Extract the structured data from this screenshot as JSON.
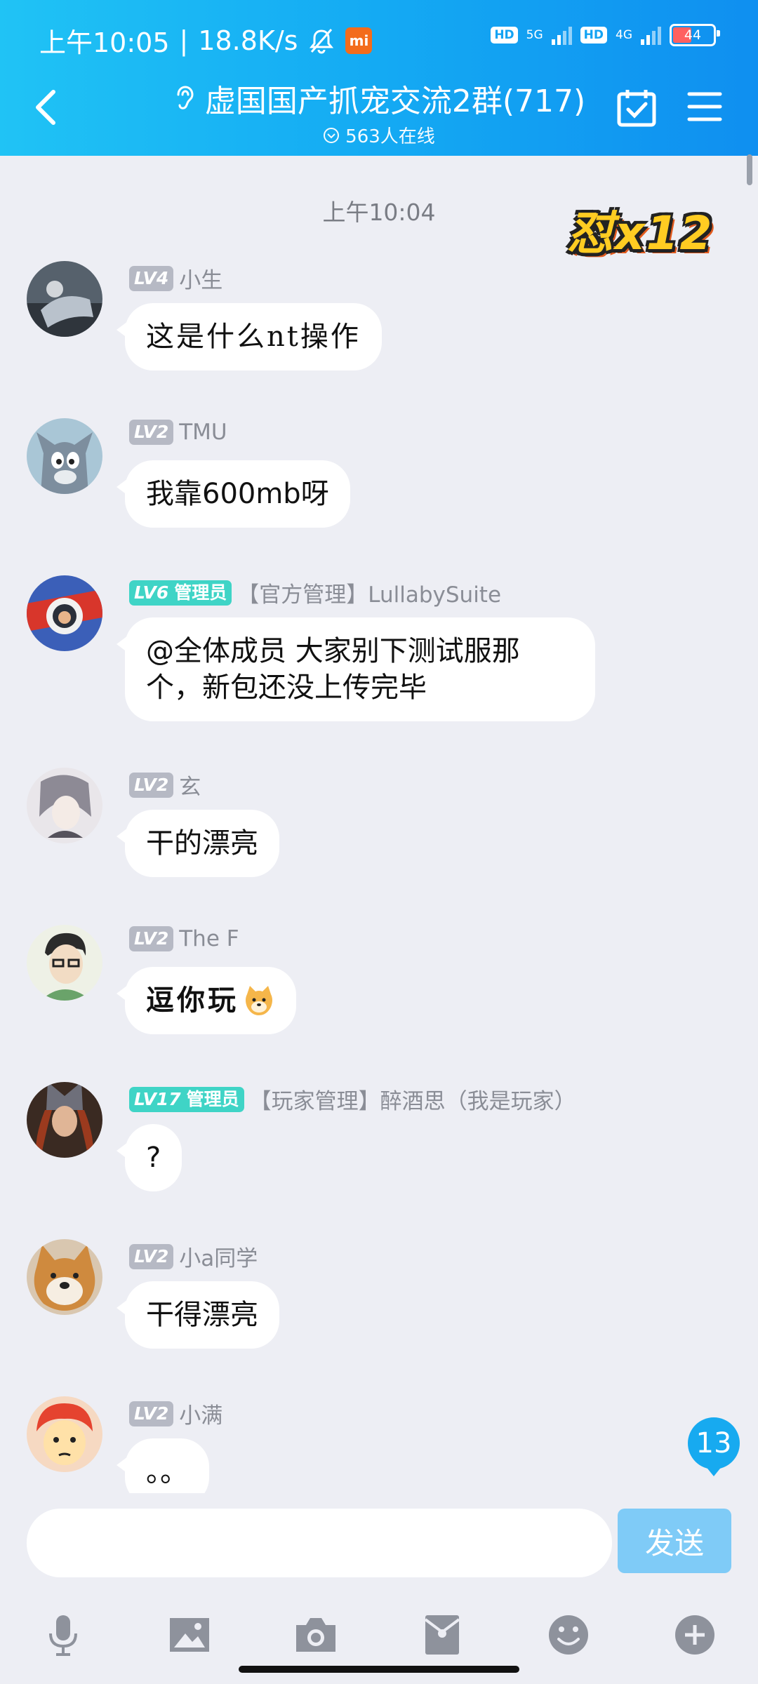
{
  "status_bar": {
    "time": "上午10:05",
    "speed": "18.8K/s",
    "mi": "mi",
    "hd1": "HD",
    "net1": "5G",
    "hd2": "HD",
    "net2": "4G",
    "battery": "44"
  },
  "header": {
    "title": "虚国国产抓宠交流2群(717)",
    "online": "563人在线"
  },
  "chat": {
    "time_divider": "上午10:04",
    "sticker": "怼x12",
    "messages": [
      {
        "level": "LV4",
        "role": "",
        "name": "小生",
        "text": "这是什么nt操作"
      },
      {
        "level": "LV2",
        "role": "",
        "name": "TMU",
        "text": "我靠600mb呀"
      },
      {
        "level": "LV6",
        "role": "管理员",
        "name": "【官方管理】LullabySuite",
        "text": "@全体成员 大家别下测试服那个，新包还没上传完毕"
      },
      {
        "level": "LV2",
        "role": "",
        "name": "玄",
        "text": "干的漂亮"
      },
      {
        "level": "LV2",
        "role": "",
        "name": "The F",
        "text": "逗你玩"
      },
      {
        "level": "LV17",
        "role": "管理员",
        "name": "【玩家管理】醉酒思（我是玩家）",
        "text": "?"
      },
      {
        "level": "LV2",
        "role": "",
        "name": "小a同学",
        "text": "干得漂亮"
      },
      {
        "level": "LV2",
        "role": "",
        "name": "小满",
        "text": "。。"
      }
    ],
    "unread_count": "13"
  },
  "input": {
    "placeholder": "",
    "send_label": "发送"
  },
  "toolbar": {
    "icons": [
      "microphone-icon",
      "image-icon",
      "camera-icon",
      "red-packet-icon",
      "emoji-icon",
      "plus-icon"
    ]
  },
  "colors": {
    "header_start": "#20c3f5",
    "header_end": "#0f8ff0",
    "admin_badge": "#3fd4c6",
    "send_button": "#7fcbf7"
  }
}
